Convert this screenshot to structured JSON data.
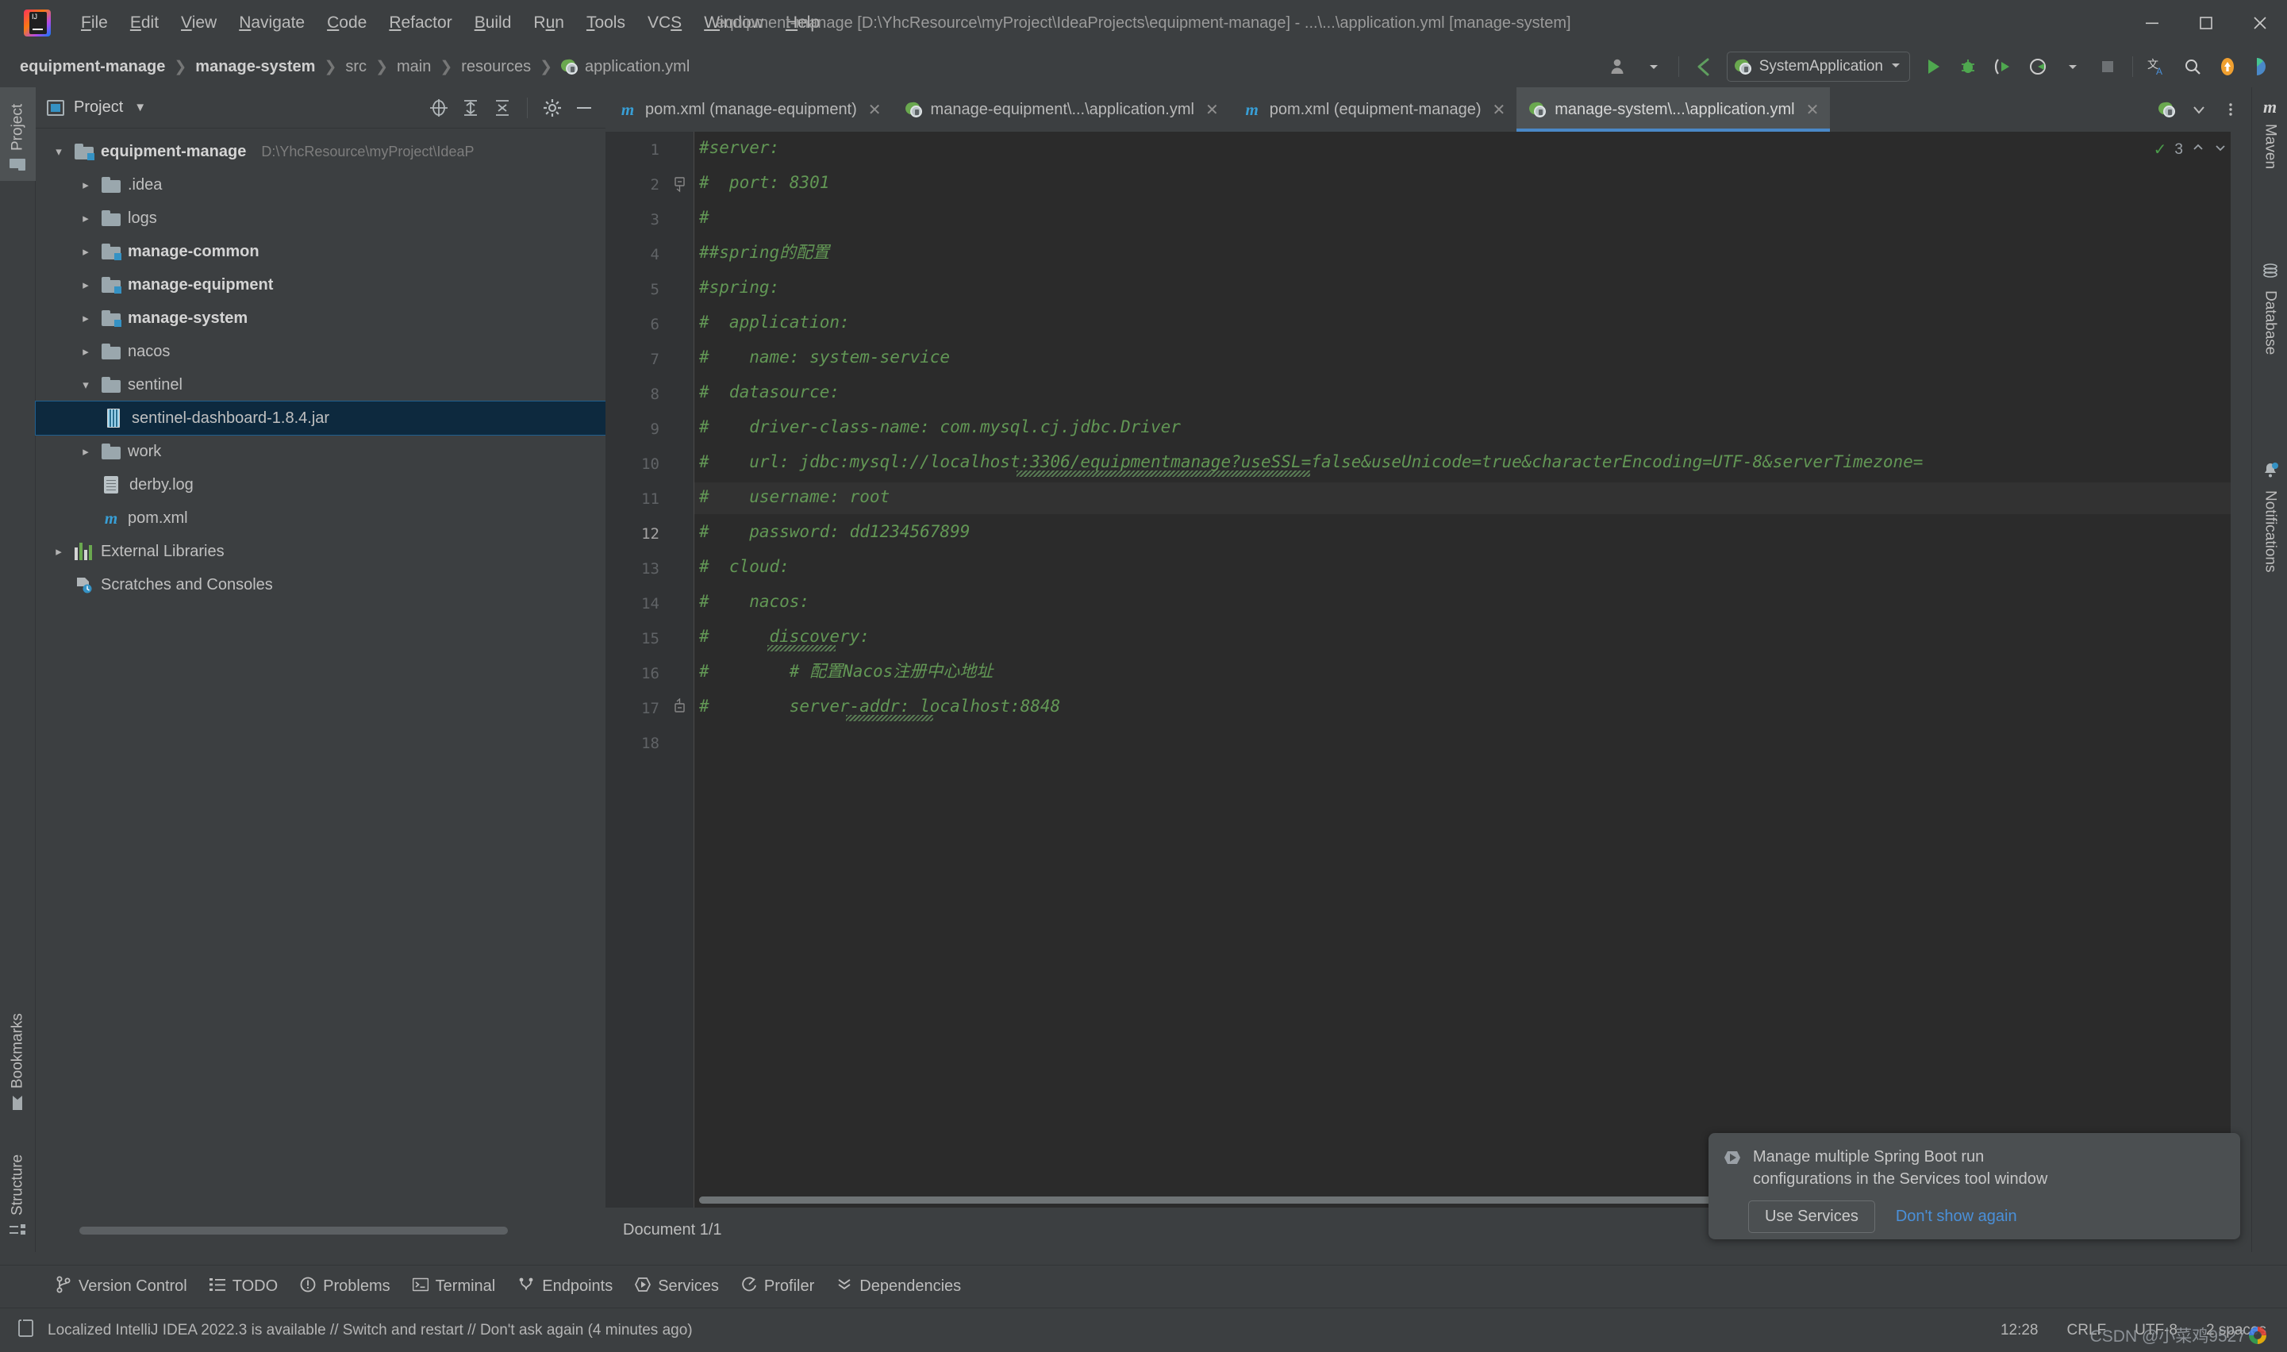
{
  "window": {
    "title": "equipment-manage [D:\\YhcResource\\myProject\\IdeaProjects\\equipment-manage] - ...\\...\\application.yml [manage-system]",
    "minimize": "minimize-icon",
    "maximize": "maximize-icon",
    "close": "close-icon"
  },
  "menu": [
    {
      "label": "File",
      "mnemonic": "F"
    },
    {
      "label": "Edit",
      "mnemonic": "E"
    },
    {
      "label": "View",
      "mnemonic": "V"
    },
    {
      "label": "Navigate",
      "mnemonic": "N"
    },
    {
      "label": "Code",
      "mnemonic": "C"
    },
    {
      "label": "Refactor",
      "mnemonic": "R"
    },
    {
      "label": "Build",
      "mnemonic": "B"
    },
    {
      "label": "Run",
      "mnemonic": "n"
    },
    {
      "label": "Tools",
      "mnemonic": "T"
    },
    {
      "label": "VCS",
      "mnemonic": "S"
    },
    {
      "label": "Window",
      "mnemonic": "W"
    },
    {
      "label": "Help",
      "mnemonic": "H"
    }
  ],
  "breadcrumb": [
    {
      "label": "equipment-manage",
      "bold": true
    },
    {
      "label": "manage-system",
      "bold": true
    },
    {
      "label": "src",
      "bold": false
    },
    {
      "label": "main",
      "bold": false
    },
    {
      "label": "resources",
      "bold": false
    },
    {
      "label": "application.yml",
      "bold": false,
      "icon": "spring-leaf-icon"
    }
  ],
  "toolbar": {
    "run_config": "SystemApplication",
    "icons": [
      "account-icon",
      "chevron-down-icon",
      "back-arrow-icon",
      "run-icon",
      "debug-icon",
      "run-with-coverage-icon",
      "profile-icon",
      "stop-icon",
      "translate-icon",
      "search-everywhere-icon",
      "update-icon",
      "ide-eval-icon"
    ]
  },
  "left_strip": [
    {
      "label": "Project",
      "selected": true
    },
    {
      "label": "Bookmarks",
      "selected": false
    },
    {
      "label": "Structure",
      "selected": false
    }
  ],
  "right_strip": [
    {
      "label": "Maven",
      "selected": false
    },
    {
      "label": "Database",
      "selected": false
    },
    {
      "label": "Notifications",
      "selected": false,
      "badge": true
    }
  ],
  "project_panel": {
    "title": "Project",
    "header_icons": [
      "locate-icon",
      "expand-all-icon",
      "collapse-all-icon",
      "gear-icon",
      "hide-icon"
    ],
    "tree": [
      {
        "label": "equipment-manage",
        "hint": "D:\\YhcResource\\myProject\\IdeaP",
        "indent": 0,
        "arrow": "down",
        "icon": "module-folder-icon",
        "bold": true,
        "selected": false
      },
      {
        "label": ".idea",
        "hint": "",
        "indent": 1,
        "arrow": "right",
        "icon": "folder-icon",
        "bold": false,
        "selected": false
      },
      {
        "label": "logs",
        "hint": "",
        "indent": 1,
        "arrow": "right",
        "icon": "folder-icon",
        "bold": false,
        "selected": false
      },
      {
        "label": "manage-common",
        "hint": "",
        "indent": 1,
        "arrow": "right",
        "icon": "module-folder-icon",
        "bold": true,
        "selected": false
      },
      {
        "label": "manage-equipment",
        "hint": "",
        "indent": 1,
        "arrow": "right",
        "icon": "module-folder-icon",
        "bold": true,
        "selected": false
      },
      {
        "label": "manage-system",
        "hint": "",
        "indent": 1,
        "arrow": "right",
        "icon": "module-folder-icon",
        "bold": true,
        "selected": false
      },
      {
        "label": "nacos",
        "hint": "",
        "indent": 1,
        "arrow": "right",
        "icon": "folder-icon",
        "bold": false,
        "selected": false
      },
      {
        "label": "sentinel",
        "hint": "",
        "indent": 1,
        "arrow": "down",
        "icon": "folder-icon",
        "bold": false,
        "selected": false
      },
      {
        "label": "sentinel-dashboard-1.8.4.jar",
        "hint": "",
        "indent": 2,
        "arrow": "none",
        "icon": "jar-icon",
        "bold": false,
        "selected": true
      },
      {
        "label": "work",
        "hint": "",
        "indent": 1,
        "arrow": "right",
        "icon": "folder-icon",
        "bold": false,
        "selected": false
      },
      {
        "label": "derby.log",
        "hint": "",
        "indent": 1,
        "arrow": "none",
        "icon": "text-file-icon",
        "bold": false,
        "selected": false
      },
      {
        "label": "pom.xml",
        "hint": "",
        "indent": 1,
        "arrow": "none",
        "icon": "maven-icon",
        "bold": false,
        "selected": false
      },
      {
        "label": "External Libraries",
        "hint": "",
        "indent": 0,
        "arrow": "right",
        "icon": "libraries-icon",
        "bold": false,
        "selected": false
      },
      {
        "label": "Scratches and Consoles",
        "hint": "",
        "indent": 0,
        "arrow": "none",
        "icon": "scratches-icon",
        "bold": false,
        "selected": false
      }
    ]
  },
  "editor": {
    "tabs": [
      {
        "label": "pom.xml (manage-equipment)",
        "icon": "maven-icon",
        "active": false,
        "closable": true
      },
      {
        "label": "manage-equipment\\...\\application.yml",
        "icon": "spring-leaf-icon",
        "active": false,
        "closable": true
      },
      {
        "label": "pom.xml (equipment-manage)",
        "icon": "maven-icon",
        "active": false,
        "closable": true
      },
      {
        "label": "manage-system\\...\\application.yml",
        "icon": "spring-leaf-icon",
        "active": true,
        "closable": true
      }
    ],
    "tab_overflow_icons": [
      "spring-leaf-icon",
      "chevron-down-icon",
      "more-vertical-icon"
    ],
    "inspection_count": "3",
    "inspection_up": "chevron-up-icon",
    "inspection_down": "chevron-down-icon",
    "document_position": "Document 1/1",
    "current_line": 12,
    "lines": [
      {
        "no": 1,
        "text": "#server:",
        "fold": "none"
      },
      {
        "no": 2,
        "text": "#  port: 8301",
        "fold": "end"
      },
      {
        "no": 3,
        "text": "#",
        "fold": "none"
      },
      {
        "no": 4,
        "text": "##spring的配置",
        "fold": "none"
      },
      {
        "no": 5,
        "text": "#spring:",
        "fold": "none"
      },
      {
        "no": 6,
        "text": "#  application:",
        "fold": "none"
      },
      {
        "no": 7,
        "text": "#    name: system-service",
        "fold": "none"
      },
      {
        "no": 8,
        "text": "#  datasource:",
        "fold": "none"
      },
      {
        "no": 9,
        "text": "#    driver-class-name: com.mysql.cj.jdbc.Driver",
        "fold": "none"
      },
      {
        "no": 10,
        "text": "#    url: jdbc:mysql://localhost:3306/equipmentmanage?useSSL=false&useUnicode=true&characterEncoding=UTF-8&serverTimezone=",
        "fold": "none"
      },
      {
        "no": 11,
        "text": "#    username: root",
        "fold": "none"
      },
      {
        "no": 12,
        "text": "#    password: dd1234567899",
        "fold": "none"
      },
      {
        "no": 13,
        "text": "#  cloud:",
        "fold": "none"
      },
      {
        "no": 14,
        "text": "#    nacos:",
        "fold": "none"
      },
      {
        "no": 15,
        "text": "#      discovery:",
        "fold": "none"
      },
      {
        "no": 16,
        "text": "#        # 配置Nacos注册中心地址",
        "fold": "start"
      },
      {
        "no": 17,
        "text": "#        server-addr: localhost:8848",
        "fold": "none"
      },
      {
        "no": 18,
        "text": "",
        "fold": "none"
      }
    ]
  },
  "balloon": {
    "icon": "services-run-icon",
    "message_line1": "Manage multiple Spring Boot run",
    "message_line2": "configurations in the Services tool window",
    "primary_button": "Use Services",
    "secondary_link": "Don't show again"
  },
  "bottom_bar": [
    {
      "label": "Version Control",
      "icon": "branch-icon"
    },
    {
      "label": "TODO",
      "icon": "todo-list-icon"
    },
    {
      "label": "Problems",
      "icon": "problems-icon"
    },
    {
      "label": "Terminal",
      "icon": "terminal-icon"
    },
    {
      "label": "Endpoints",
      "icon": "endpoints-icon"
    },
    {
      "label": "Services",
      "icon": "services-icon"
    },
    {
      "label": "Profiler",
      "icon": "profiler-icon"
    },
    {
      "label": "Dependencies",
      "icon": "dependencies-icon"
    }
  ],
  "status_bar": {
    "icon": "event-log-icon",
    "message": "Localized IntelliJ IDEA 2022.3 is available // Switch and restart // Don't ask again (4 minutes ago)",
    "time": "12:28",
    "line_separator": "CRLF",
    "encoding": "UTF-8",
    "indent": "2 spaces",
    "watermark": "CSDN @小菜鸡9527"
  },
  "colors": {
    "background": "#3c3f41",
    "editor_bg": "#2b2b2b",
    "comment_green": "#629755",
    "accent_blue": "#4a88c7",
    "selection_blue": "#0d293e",
    "link_blue": "#4a90d9"
  }
}
